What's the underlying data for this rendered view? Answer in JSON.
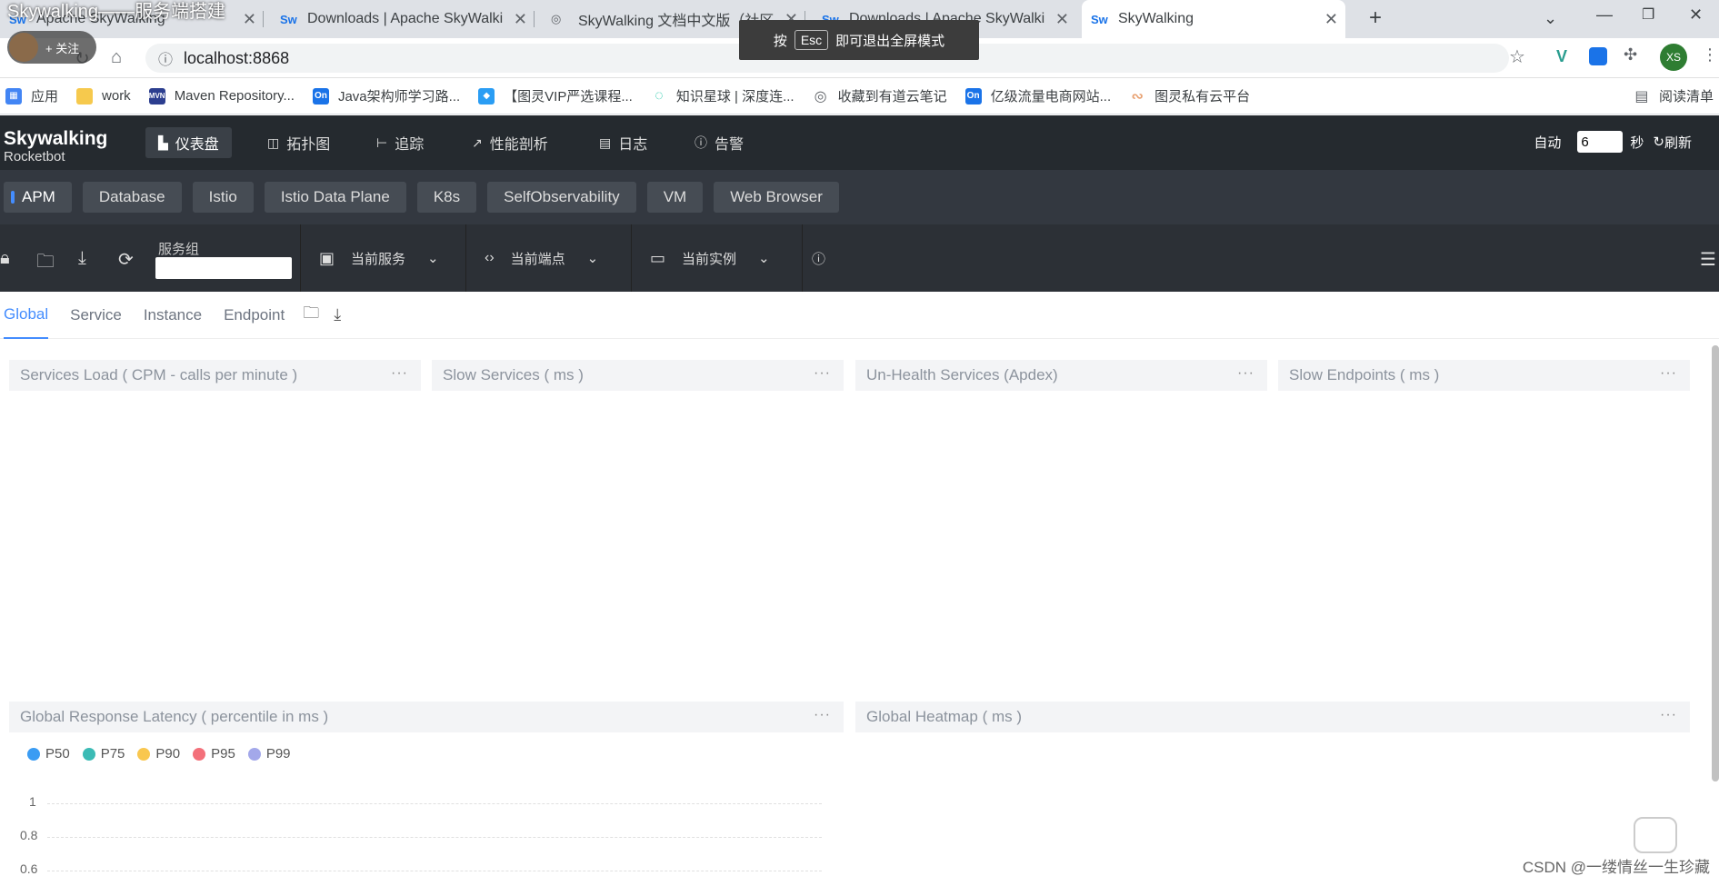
{
  "overlay": {
    "video_title": "Skywalking——服务端搭建",
    "follow_label": "+ 关注",
    "fullscreen_hint_pre": "按",
    "fullscreen_hint_key": "Esc",
    "fullscreen_hint_post": "即可退出全屏模式",
    "watermark": "CSDN @一缕情丝一生珍藏"
  },
  "browser": {
    "tabs": [
      {
        "label": "Apache SkyWalking",
        "icon": "Sw"
      },
      {
        "label": "Downloads | Apache SkyWalki",
        "icon": "Sw"
      },
      {
        "label": "SkyWalking 文档中文版（社区",
        "icon": "globe"
      },
      {
        "label": "Downloads | Apache SkyWalki",
        "icon": "Sw"
      },
      {
        "label": "SkyWalking",
        "icon": "Sw"
      }
    ],
    "url": "localhost:8868",
    "profile_initials": "XS",
    "bookmarks": [
      {
        "label": "应用",
        "color": "#4285f4"
      },
      {
        "label": "work",
        "color": "#f6c94d"
      },
      {
        "label": "Maven Repository...",
        "color": "#2c3e8f"
      },
      {
        "label": "Java架构师学习路...",
        "color": "#1a73e8"
      },
      {
        "label": "【图灵VIP严选课程...",
        "color": "#2a9df4"
      },
      {
        "label": "知识星球 | 深度连...",
        "color": "#19c5a5"
      },
      {
        "label": "收藏到有道云笔记",
        "color": "#5f6368"
      },
      {
        "label": "亿级流量电商网站...",
        "color": "#1a73e8"
      },
      {
        "label": "图灵私有云平台",
        "color": "#e8a070"
      }
    ],
    "reading_list": "阅读清单"
  },
  "app": {
    "logo_title": "Skywalking",
    "logo_subtitle": "Rocketbot",
    "nav": [
      {
        "label": "仪表盘",
        "icon": "📊"
      },
      {
        "label": "拓扑图",
        "icon": "◫"
      },
      {
        "label": "追踪",
        "icon": "⊢"
      },
      {
        "label": "性能剖析",
        "icon": "↗"
      },
      {
        "label": "日志",
        "icon": "▤"
      },
      {
        "label": "告警",
        "icon": "ⓘ"
      }
    ],
    "auto_label": "自动",
    "auto_value": "6",
    "seconds_label": "秒",
    "refresh_label": "刷新",
    "layers": [
      "APM",
      "Database",
      "Istio",
      "Istio Data Plane",
      "K8s",
      "SelfObservability",
      "VM",
      "Web Browser"
    ],
    "toolbar": {
      "service_group_label": "服务组",
      "current_service": "当前服务",
      "current_endpoint": "当前端点",
      "current_instance": "当前实例"
    },
    "dash_tabs": [
      "Global",
      "Service",
      "Instance",
      "Endpoint"
    ],
    "panels": [
      "Services Load ( CPM - calls per minute )",
      "Slow Services ( ms )",
      "Un-Health Services (Apdex)",
      "Slow Endpoints ( ms )",
      "Global Response Latency ( percentile in ms )",
      "Global Heatmap ( ms )"
    ],
    "more_icon": "···",
    "legend": [
      {
        "label": "P50",
        "color": "#3b9cf3"
      },
      {
        "label": "P75",
        "color": "#3bbbb5"
      },
      {
        "label": "P90",
        "color": "#f9c74f"
      },
      {
        "label": "P95",
        "color": "#f3707a"
      },
      {
        "label": "P99",
        "color": "#a3a8ea"
      }
    ],
    "y_ticks": [
      "1",
      "0.8",
      "0.6"
    ]
  }
}
